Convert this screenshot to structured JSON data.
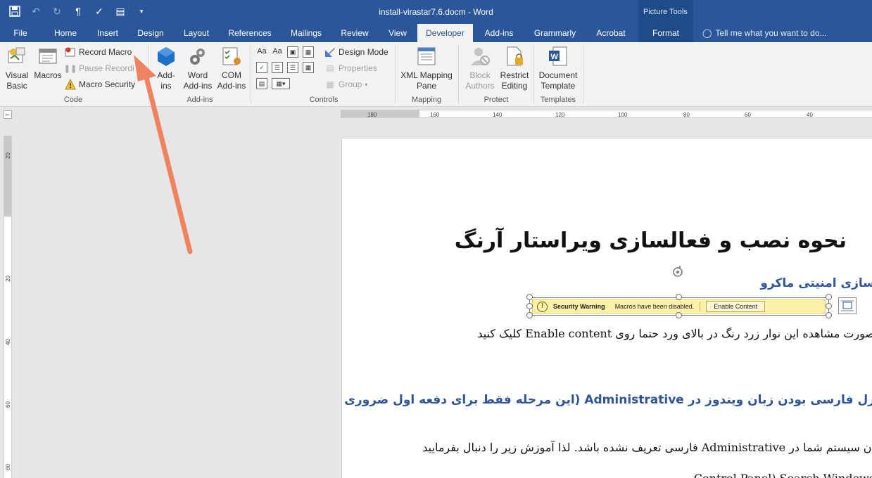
{
  "window": {
    "title": "install-virastar7.6.docm - Word",
    "context_tool": "Picture Tools"
  },
  "qat": {
    "icons": [
      "save-icon",
      "undo-icon",
      "redo-icon",
      "pilcrow-icon",
      "format-painter-icon",
      "print-layout-icon",
      "customize-icon"
    ]
  },
  "tabs": {
    "file": "File",
    "home": "Home",
    "insert": "Insert",
    "design": "Design",
    "layout": "Layout",
    "references": "References",
    "mailings": "Mailings",
    "review": "Review",
    "view": "View",
    "developer": "Developer",
    "addins": "Add-ins",
    "grammarly": "Grammarly",
    "acrobat": "Acrobat",
    "format": "Format",
    "tellme": "Tell me what you want to do..."
  },
  "ribbon": {
    "code": {
      "label": "Code",
      "visual_basic_1": "Visual",
      "visual_basic_2": "Basic",
      "macros": "Macros",
      "record_macro": "Record Macro",
      "pause_recording": "Pause Recordi",
      "macro_security": "Macro Security"
    },
    "addins": {
      "label": "Add-ins",
      "addins_1": "Add-",
      "addins_2": "ins",
      "word_addins_1": "Word",
      "word_addins_2": "Add-ins",
      "com_addins_1": "COM",
      "com_addins_2": "Add-ins"
    },
    "controls": {
      "label": "Controls",
      "design_mode": "Design Mode",
      "properties": "Properties",
      "group": "Group"
    },
    "mapping": {
      "label": "Mapping",
      "xml_1": "XML Mapping",
      "xml_2": "Pane"
    },
    "protect": {
      "label": "Protect",
      "block_1": "Block",
      "block_2": "Authors",
      "restrict_1": "Restrict",
      "restrict_2": "Editing"
    },
    "templates": {
      "label": "Templates",
      "doc_1": "Document",
      "doc_2": "Template"
    }
  },
  "rulers": {
    "horizontal": [
      "180",
      "160",
      "140",
      "120",
      "100",
      "80",
      "60",
      "40"
    ],
    "vertical": [
      "20",
      "20",
      "40",
      "60",
      "80"
    ]
  },
  "document": {
    "heading": "نحوه نصب و فعالسازی ویراستار آرنگ",
    "section1": "سازی امنیتی ماکرو",
    "para1": "صورت مشاهده این نوار زرد رنگ در بالای ورد حتما روی Enable content کلیک کنید",
    "section2": "رل فارسی بودن زبان ویندوز در Administrative (این مرحله فقط برای دفعه اول ضروری",
    "para2": "ان سیستم شما در Administrative فارسی تعریف نشده باشد. لذا آموزش زیر را دنبال بفرمایید",
    "para3": "Control Panel) Search Windows"
  },
  "security_bar": {
    "title": "Security Warning",
    "message": "Macros have been disabled.",
    "button": "Enable Content"
  },
  "colors": {
    "word_blue": "#2b579a",
    "warning_yellow": "#fbf1a8",
    "annotation_arrow": "#f0835f"
  }
}
